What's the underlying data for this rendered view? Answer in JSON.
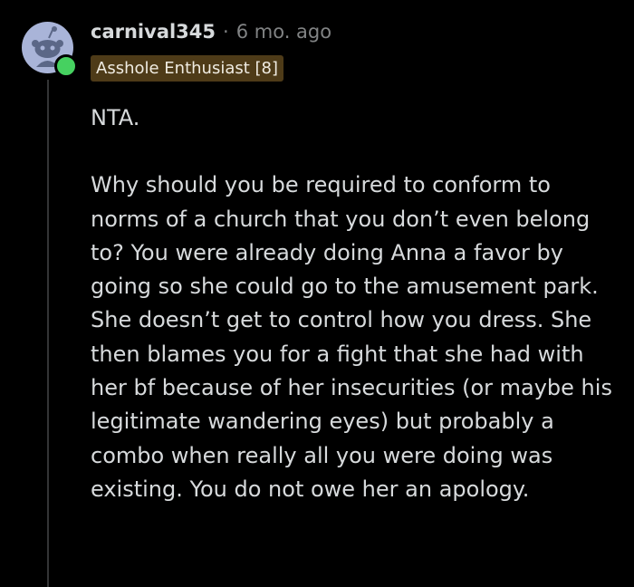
{
  "comment": {
    "author": "carnival345",
    "separator": "·",
    "timestamp": "6 mo. ago",
    "flair": "Asshole Enthusiast [8]",
    "paragraphs": [
      "NTA.",
      "Why should you be required to conform to norms of a church that you don’t even belong to? You were already doing Anna a favor by going so she could go to the amusement park. She doesn’t get to control how you dress. She then blames you for a fight that she had with her bf because of her insecurities (or maybe his legitimate wandering eyes) but probably a combo when really all you were doing was existing. You do not owe her an apology."
    ]
  },
  "colors": {
    "background": "#000000",
    "text": "#d7dadc",
    "meta": "#818384",
    "flair_bg": "#4e3b18",
    "avatar_bg": "#a9b4d8",
    "online": "#46d160"
  },
  "icons": {
    "avatar": "snoo-avatar-icon",
    "online_indicator": "online-status-icon"
  }
}
